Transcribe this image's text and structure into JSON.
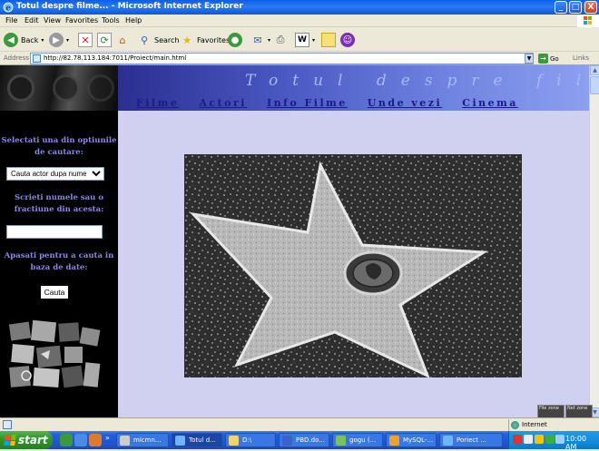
{
  "window": {
    "title": "Totul despre filme... - Microsoft Internet Explorer",
    "buttons": [
      "_",
      "□",
      "X"
    ]
  },
  "menu": [
    "File",
    "Edit",
    "View",
    "Favorites",
    "Tools",
    "Help"
  ],
  "toolbar": {
    "back": "Back",
    "search": "Search",
    "favorites": "Favorites"
  },
  "address": {
    "label": "Address",
    "url": "http://82.78.113.184:7011/Proiect/main.html",
    "go": "Go",
    "links": "Links"
  },
  "page": {
    "site_title": "Totul despre filme",
    "nav": [
      "Filme",
      "Actori",
      "Info Filme",
      "Unde vezi",
      "Cinema"
    ],
    "sidebar": {
      "prompt_select": "Selectati una din optiunile de cautare:",
      "select_value": "Cauta actor dupa nume",
      "prompt_name": "Scrieti numele sau o fractiune din acesta:",
      "name_value": "",
      "prompt_search": "Apasati pentru a cauta in baza de date:",
      "search_button": "Cauta"
    }
  },
  "statusbar": {
    "zone": "Internet",
    "file_zone": "File zone",
    "net_zone": "Net zone"
  },
  "taskbar": {
    "start": "start",
    "tasks": [
      "micmn...",
      "Totul d...",
      "D:\\",
      "PBD.do...",
      "gogu (...",
      "MySQL-...",
      "Poriect ..."
    ],
    "clock": "10:00 AM"
  },
  "colors": {
    "content_bg": "#d0d0f0",
    "sidebar_text": "#8a86e6",
    "nav_link": "#1a1a8a",
    "header_title": "#a9b8f5"
  }
}
